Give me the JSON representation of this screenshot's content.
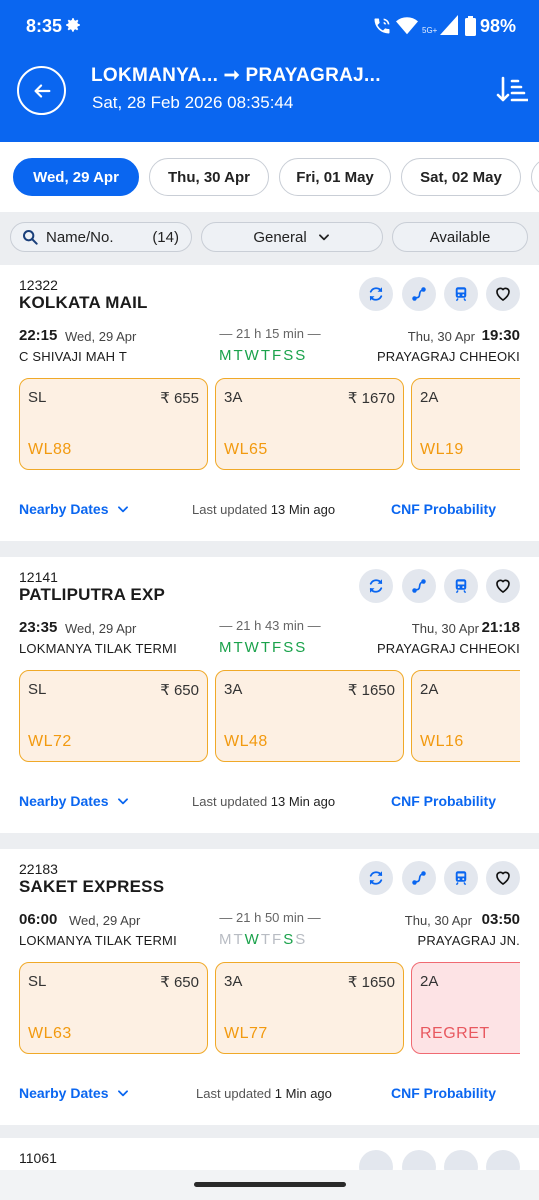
{
  "status_bar": {
    "time": "8:35",
    "network": "5G+",
    "battery": "98%"
  },
  "header": {
    "route": "LOKMANYA... ➞ PRAYAGRAJ...",
    "datetime": "Sat, 28 Feb 2026 08:35:44",
    "icons": [
      "back-arrow-icon",
      "sort-icon"
    ]
  },
  "date_tabs": [
    {
      "label": "Wed, 29 Apr",
      "active": true
    },
    {
      "label": "Thu, 30 Apr",
      "active": false
    },
    {
      "label": "Fri, 01 May",
      "active": false
    },
    {
      "label": "Sat, 02 May",
      "active": false
    }
  ],
  "filters": {
    "name_label": "Name/No.",
    "count": "(14)",
    "quota": "General",
    "availability": "Available"
  },
  "trains": [
    {
      "number": "12322",
      "name": "KOLKATA MAIL",
      "dep_time": "22:15",
      "dep_date": "Wed, 29 Apr",
      "duration": "— 21 h 15 min —",
      "arr_date": "Thu, 30 Apr",
      "arr_time": "19:30",
      "from": "C SHIVAJI MAH T",
      "to": "PRAYAGRAJ CHHEOKI",
      "days": [
        [
          "M",
          1
        ],
        [
          "T",
          1
        ],
        [
          "W",
          1
        ],
        [
          "T",
          1
        ],
        [
          "F",
          1
        ],
        [
          "S",
          1
        ],
        [
          "S",
          1
        ]
      ],
      "classes": [
        {
          "name": "SL",
          "price": "₹ 655",
          "status": "WL88",
          "regret": false
        },
        {
          "name": "3A",
          "price": "₹ 1670",
          "status": "WL65",
          "regret": false
        },
        {
          "name": "2A",
          "price": "",
          "status": "WL19",
          "regret": false
        }
      ],
      "nearby": "Nearby Dates",
      "updated_prefix": "Last updated ",
      "updated_value": "13 Min ago",
      "cnf": "CNF Probability"
    },
    {
      "number": "12141",
      "name": "PATLIPUTRA EXP",
      "dep_time": "23:35",
      "dep_date": "Wed, 29 Apr",
      "duration": "— 21 h 43 min —",
      "arr_date": "Thu, 30 Apr",
      "arr_time": "21:18",
      "from": "LOKMANYA TILAK TERMI",
      "to": "PRAYAGRAJ CHHEOKI",
      "days": [
        [
          "M",
          1
        ],
        [
          "T",
          1
        ],
        [
          "W",
          1
        ],
        [
          "T",
          1
        ],
        [
          "F",
          1
        ],
        [
          "S",
          1
        ],
        [
          "S",
          1
        ]
      ],
      "classes": [
        {
          "name": "SL",
          "price": "₹ 650",
          "status": "WL72",
          "regret": false
        },
        {
          "name": "3A",
          "price": "₹ 1650",
          "status": "WL48",
          "regret": false
        },
        {
          "name": "2A",
          "price": "",
          "status": "WL16",
          "regret": false
        }
      ],
      "nearby": "Nearby Dates",
      "updated_prefix": "Last updated ",
      "updated_value": "13 Min ago",
      "cnf": "CNF Probability"
    },
    {
      "number": "22183",
      "name": "SAKET EXPRESS",
      "dep_time": "06:00",
      "dep_date": "Wed, 29 Apr",
      "duration": "— 21 h 50 min —",
      "arr_date": "Thu, 30 Apr",
      "arr_time": "03:50",
      "from": "LOKMANYA TILAK TERMI",
      "to": "PRAYAGRAJ JN.",
      "days": [
        [
          "M",
          0
        ],
        [
          "T",
          0
        ],
        [
          "W",
          1
        ],
        [
          "T",
          0
        ],
        [
          "F",
          0
        ],
        [
          "S",
          1
        ],
        [
          "S",
          0
        ]
      ],
      "classes": [
        {
          "name": "SL",
          "price": "₹ 650",
          "status": "WL63",
          "regret": false
        },
        {
          "name": "3A",
          "price": "₹ 1650",
          "status": "WL77",
          "regret": false
        },
        {
          "name": "2A",
          "price": "",
          "status": "REGRET",
          "regret": true
        }
      ],
      "nearby": "Nearby Dates",
      "updated_prefix": "Last updated ",
      "updated_value": "1 Min ago",
      "cnf": "CNF Probability"
    },
    {
      "number": "11061"
    }
  ],
  "colors": {
    "primary": "#0a66f0",
    "waitlist": "#f29a10",
    "regret": "#e8585f",
    "running_day": "#1aa24b"
  }
}
